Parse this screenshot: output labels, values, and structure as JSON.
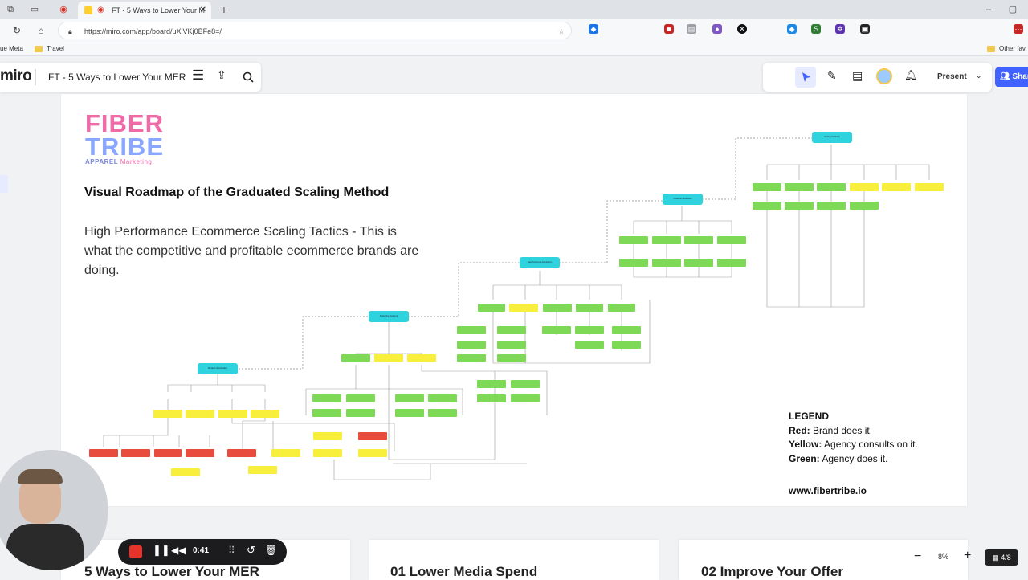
{
  "browser": {
    "tab_title": "FT - 5 Ways to Lower Your M",
    "url": "https://miro.com/app/board/uXjVKj0BFe8=/",
    "bookmarks": [
      "ue Meta",
      "Travel"
    ],
    "other_bookmarks": "Other fav"
  },
  "miro": {
    "logo": "miro",
    "board_title": "FT - 5 Ways to Lower Your MER",
    "present_label": "Present",
    "share_label": "Shar",
    "zoom": "8%",
    "frames_count": "4/8"
  },
  "board": {
    "logo_top": "FIBER",
    "logo_bottom": "TRIBE",
    "logo_sub": "APPAREL",
    "logo_sub2": "Marketing",
    "heading": "Visual Roadmap of the Graduated Scaling Method",
    "subtitle": "High Performance Ecommerce Scaling Tactics - This is what the competitive and profitable ecommerce brands are doing.",
    "legend_title": "LEGEND",
    "legend_red_key": "Red:",
    "legend_red_text": " Brand does it.",
    "legend_yellow_key": "Yellow:",
    "legend_yellow_text": " Agency consults on it.",
    "legend_green_key": "Green:",
    "legend_green_text": " Agency does it.",
    "website": "www.fibertribe.io",
    "diagram_headers": {
      "product_optimization": "Product Optimization",
      "marketing_systems": "Marketing Systems",
      "new_customer_acquisition": "New Customer Acquisition",
      "customer_retention": "Customer Retention",
      "scaling_profitably": "Scaling Profitably"
    }
  },
  "frames": {
    "f1": "5 Ways to Lower Your MER",
    "f2": "01 Lower Media Spend",
    "f3": "02 Improve Your Offer"
  },
  "recorder": {
    "time": "0:41"
  },
  "colors": {
    "miro_blue": "#4262ff",
    "node_green": "#7ed957",
    "node_yellow": "#f8ef3c",
    "node_red": "#e74c3c",
    "node_cyan": "#2fd3dd",
    "logo_pink": "#f06aa8",
    "logo_blue": "#8aa7ff",
    "rec_red": "#e5352b"
  }
}
